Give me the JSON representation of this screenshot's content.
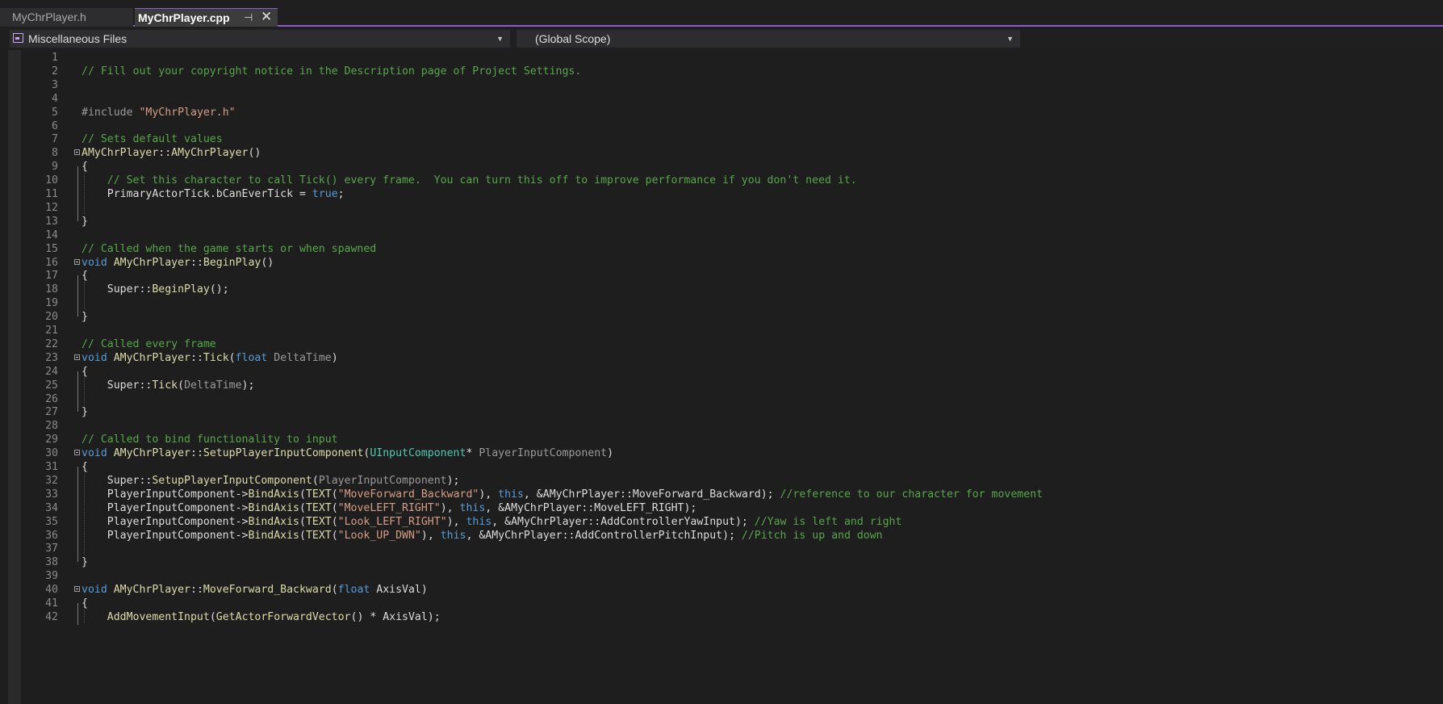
{
  "tabs": [
    {
      "label": "MyChrPlayer.h"
    },
    {
      "label": "MyChrPlayer.cpp"
    }
  ],
  "icons": {
    "pin": "pin-icon",
    "close": "close-icon",
    "project": "project-files-icon",
    "dropdown": "chevron-down-icon"
  },
  "navbar": {
    "project": "Miscellaneous Files",
    "scope": "(Global Scope)"
  },
  "colors": {
    "accent": "#8a5cd6",
    "comment": "#57a64a",
    "keyword": "#569cd6",
    "string": "#d69d85",
    "function": "#dcdcaa",
    "type": "#4ec9b0",
    "background": "#1e1e1e"
  },
  "editor": {
    "line_numbers": [
      "1",
      "2",
      "3",
      "4",
      "5",
      "6",
      "7",
      "8",
      "9",
      "10",
      "11",
      "12",
      "13",
      "14",
      "15",
      "16",
      "17",
      "18",
      "19",
      "20",
      "21",
      "22",
      "23",
      "24",
      "25",
      "26",
      "27",
      "28",
      "29",
      "30",
      "31",
      "32",
      "33",
      "34",
      "35",
      "36",
      "37",
      "38",
      "39",
      "40",
      "41",
      "42"
    ],
    "lines": [
      "",
      "// Fill out your copyright notice in the Description page of Project Settings.",
      "",
      "",
      "#include \"MyChrPlayer.h\"",
      "",
      "// Sets default values",
      "AMyChrPlayer::AMyChrPlayer()",
      "{",
      "    // Set this character to call Tick() every frame.  You can turn this off to improve performance if you don't need it.",
      "    PrimaryActorTick.bCanEverTick = true;",
      "",
      "}",
      "",
      "// Called when the game starts or when spawned",
      "void AMyChrPlayer::BeginPlay()",
      "{",
      "    Super::BeginPlay();",
      "",
      "}",
      "",
      "// Called every frame",
      "void AMyChrPlayer::Tick(float DeltaTime)",
      "{",
      "    Super::Tick(DeltaTime);",
      "",
      "}",
      "",
      "// Called to bind functionality to input",
      "void AMyChrPlayer::SetupPlayerInputComponent(UInputComponent* PlayerInputComponent)",
      "{",
      "    Super::SetupPlayerInputComponent(PlayerInputComponent);",
      "    PlayerInputComponent->BindAxis(TEXT(\"MoveForward_Backward\"), this, &AMyChrPlayer::MoveForward_Backward); //reference to our character for movement",
      "    PlayerInputComponent->BindAxis(TEXT(\"MoveLEFT_RIGHT\"), this, &AMyChrPlayer::MoveLEFT_RIGHT);",
      "    PlayerInputComponent->BindAxis(TEXT(\"Look_LEFT_RIGHT\"), this, &AMyChrPlayer::AddControllerYawInput); //Yaw is left and right",
      "    PlayerInputComponent->BindAxis(TEXT(\"Look_UP_DWN\"), this, &AMyChrPlayer::AddControllerPitchInput); //Pitch is up and down",
      "",
      "}",
      "",
      "void AMyChrPlayer::MoveForward_Backward(float AxisVal)",
      "{",
      "    AddMovementInput(GetActorForwardVector() * AxisVal);"
    ]
  }
}
